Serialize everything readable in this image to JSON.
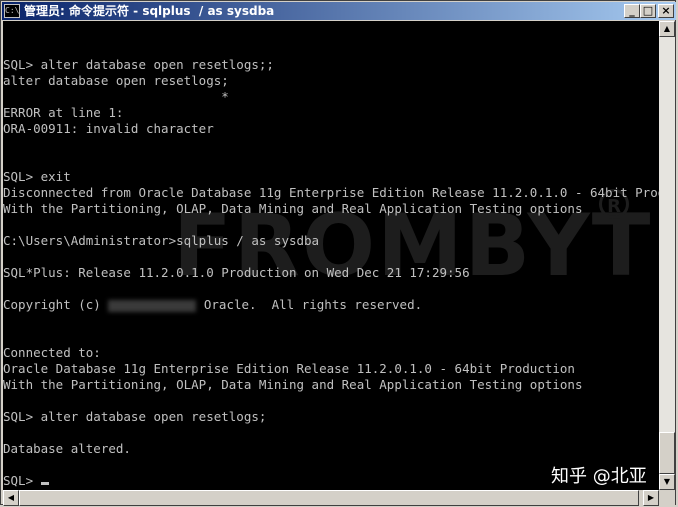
{
  "window": {
    "title": "管理员: 命令提示符 - sqlplus  / as sysdba",
    "buttons": {
      "minimize": "_",
      "maximize": "□",
      "close": "×"
    }
  },
  "console": {
    "lines": [
      "",
      "",
      "SQL> alter database open resetlogs;;",
      "alter database open resetlogs;",
      "                             *",
      "ERROR at line 1:",
      "ORA-00911: invalid character",
      "",
      "",
      "SQL> exit",
      "Disconnected from Oracle Database 11g Enterprise Edition Release 11.2.0.1.0 - 64bit Production",
      "With the Partitioning, OLAP, Data Mining and Real Application Testing options",
      "",
      "C:\\Users\\Administrator>sqlplus / as sysdba",
      "",
      "SQL*Plus: Release 11.2.0.1.0 Production on Wed Dec 21 17:29:56",
      "",
      "",
      "",
      "",
      "Connected to:",
      "Oracle Database 11g Enterprise Edition Release 11.2.0.1.0 - 64bit Production",
      "With the Partitioning, OLAP, Data Mining and Real Application Testing options",
      "",
      "SQL> alter database open resetlogs;",
      "",
      "Database altered.",
      "",
      "SQL> "
    ],
    "copyright_prefix": "Copyright (c) ",
    "copyright_suffix": " Oracle.  All rights reserved."
  },
  "watermark": {
    "text": "FROMBYTE",
    "mark": "R"
  },
  "zhihu_watermark": "知乎 @北亚",
  "colors": {
    "console_bg": "#000000",
    "console_fg": "#c0c0c0",
    "title_start": "#0a246a",
    "title_end": "#a6caf0"
  }
}
